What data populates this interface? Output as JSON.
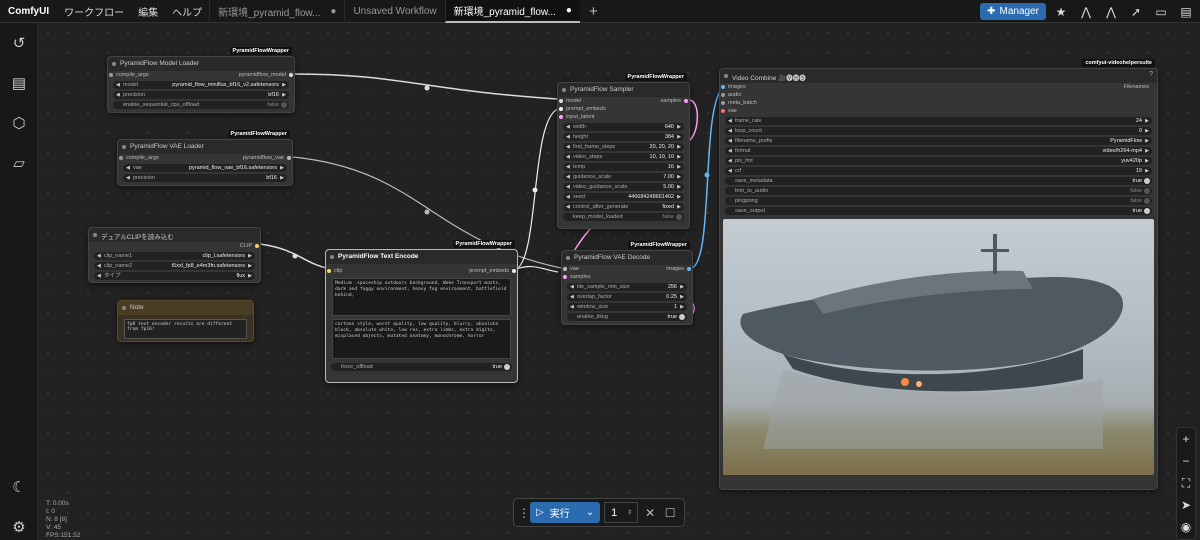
{
  "topbar": {
    "brand": "ComfyUI",
    "menus": [
      "ワークフロー",
      "編集",
      "ヘルプ"
    ],
    "tabs": [
      {
        "label": "新環境_pyramid_flow..."
      },
      {
        "label": "Unsaved Workflow"
      },
      {
        "label": "新環境_pyramid_flow..."
      }
    ],
    "manager": "Manager"
  },
  "nodes": {
    "model_loader": {
      "title": "PyramidFlow Model Loader",
      "badge": "PyramidFlowWrapper",
      "in": "compile_args",
      "out": "pyramidflow_model",
      "widgets": [
        {
          "k": "model",
          "v": "pyramid_flow_miniflux_bf16_v2.safetensors"
        },
        {
          "k": "precision",
          "v": "bf16"
        },
        {
          "k": "enable_sequential_cpu_offload",
          "v": "false"
        }
      ]
    },
    "vae_loader": {
      "title": "PyramidFlow VAE Loader",
      "badge": "PyramidFlowWrapper",
      "in": "compile_args",
      "out": "pyramidflow_vae",
      "widgets": [
        {
          "k": "vae",
          "v": "pyramid_flow_vae_bf16.safetensors"
        },
        {
          "k": "precision",
          "v": "bf16"
        }
      ]
    },
    "clip_loader": {
      "title": "デュアルCLIPを読み込む",
      "out": "CLIP",
      "widgets": [
        {
          "k": "clip_name1",
          "v": "clip_l.safetensors"
        },
        {
          "k": "clip_name2",
          "v": "t5xxl_fp8_e4m3fn.safetensors"
        },
        {
          "k": "タイプ",
          "v": "flux"
        }
      ]
    },
    "note": {
      "title": "Note",
      "text": "fp8 text encoder results are different from fp16!"
    },
    "text_encode": {
      "title": "PyramidFlow Text Encode",
      "badge": "PyramidFlowWrapper",
      "in": "clip",
      "out": "prompt_embeds",
      "positive": "Medium .spaceship outdoors background, Woke Transport mosts, dark and foggy environment, heavy fog environment, battlefield behind,",
      "negative": "cartoon style, worst quality, low quality, blurry, absolute black, absolute white, low res, extra limbs, extra digits, misplaced objects, mutated anatomy, monochrome, horror",
      "toggle": {
        "k": "force_offload",
        "v": "true"
      }
    },
    "sampler": {
      "title": "PyramidFlow Sampler",
      "badge": "PyramidFlowWrapper",
      "inputs": [
        "model",
        "prompt_embeds",
        "input_latent"
      ],
      "out": "samples",
      "widgets": [
        {
          "k": "width",
          "v": "640"
        },
        {
          "k": "height",
          "v": "384"
        },
        {
          "k": "first_frame_steps",
          "v": "20, 20, 20"
        },
        {
          "k": "video_steps",
          "v": "10, 10, 10"
        },
        {
          "k": "temp",
          "v": "16"
        },
        {
          "k": "guidance_scale",
          "v": "7.00"
        },
        {
          "k": "video_guidance_scale",
          "v": "5.00"
        },
        {
          "k": "seed",
          "v": "446684248661402"
        },
        {
          "k": "control_after_generate",
          "v": "fixed"
        },
        {
          "k": "keep_model_loaded",
          "v": "false"
        }
      ]
    },
    "vae_decode": {
      "title": "PyramidFlow VAE Decode",
      "badge": "PyramidFlowWrapper",
      "inputs": [
        "vae",
        "samples"
      ],
      "out": "images",
      "widgets": [
        {
          "k": "tile_sample_min_size",
          "v": "256"
        },
        {
          "k": "overlap_factor",
          "v": "0.25"
        },
        {
          "k": "window_size",
          "v": "1"
        },
        {
          "k": "enable_tiling",
          "v": "true"
        }
      ]
    },
    "video_combine": {
      "title": "Video Combine 🎥🅥🅗🅢",
      "badge": "comfyui-videohelpersuite",
      "inputs": [
        "images",
        "audio",
        "meta_batch",
        "vae"
      ],
      "out": "Filenames",
      "widgets": [
        {
          "k": "frame_rate",
          "v": "24"
        },
        {
          "k": "loop_count",
          "v": "0"
        },
        {
          "k": "filename_prefix",
          "v": "PyramidFlow"
        },
        {
          "k": "format",
          "v": "video/h264-mp4"
        },
        {
          "k": "pix_fmt",
          "v": "yuv420p"
        },
        {
          "k": "crf",
          "v": "19"
        },
        {
          "k": "save_metadata",
          "v": "true"
        },
        {
          "k": "trim_to_audio",
          "v": "false"
        },
        {
          "k": "pingpong",
          "v": "false"
        },
        {
          "k": "save_output",
          "v": "true"
        }
      ]
    }
  },
  "run": {
    "label": "実行",
    "count": "1"
  },
  "stats": {
    "t": "T: 0.00s",
    "i": "I: 0",
    "n": "N: 8 [8]",
    "v": "V: 45",
    "fps": "FPS:151.52"
  },
  "colors": {
    "accent": "#2b6cb0",
    "wire_clip": "#f2d85a",
    "wire_model": "#dddddd",
    "wire_latent": "#ff9cf9",
    "wire_image": "#64b5f6"
  }
}
